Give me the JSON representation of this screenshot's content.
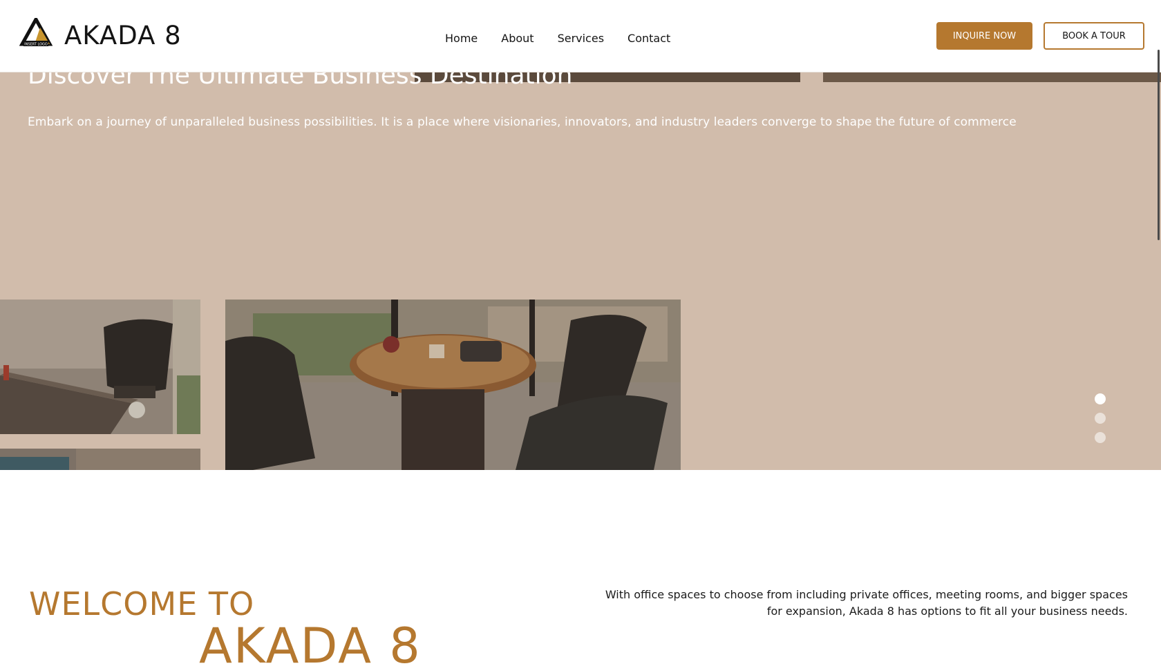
{
  "header": {
    "brand": "AKADA 8",
    "logo_caption": "INSERT LOGO",
    "nav": [
      "Home",
      "About",
      "Services",
      "Contact"
    ],
    "inquire_label": "INQUIRE NOW",
    "tour_label": "BOOK A TOUR"
  },
  "hero": {
    "title": "Discover The Ultimate Business Destination",
    "text": "Embark on a journey of unparalleled business possibilities. It is a place where visionaries, innovators, and industry leaders converge to shape the future of commerce",
    "slides": 3,
    "active_slide": 1
  },
  "welcome": {
    "line1": "WELCOME TO",
    "line2": "AKADA 8",
    "text": "With office spaces to choose from including private offices, meeting rooms, and bigger spaces for expansion, Akada 8 has options to fit all your business needs."
  },
  "colors": {
    "accent": "#b5782f",
    "hero_overlay": "#d1bcab"
  }
}
